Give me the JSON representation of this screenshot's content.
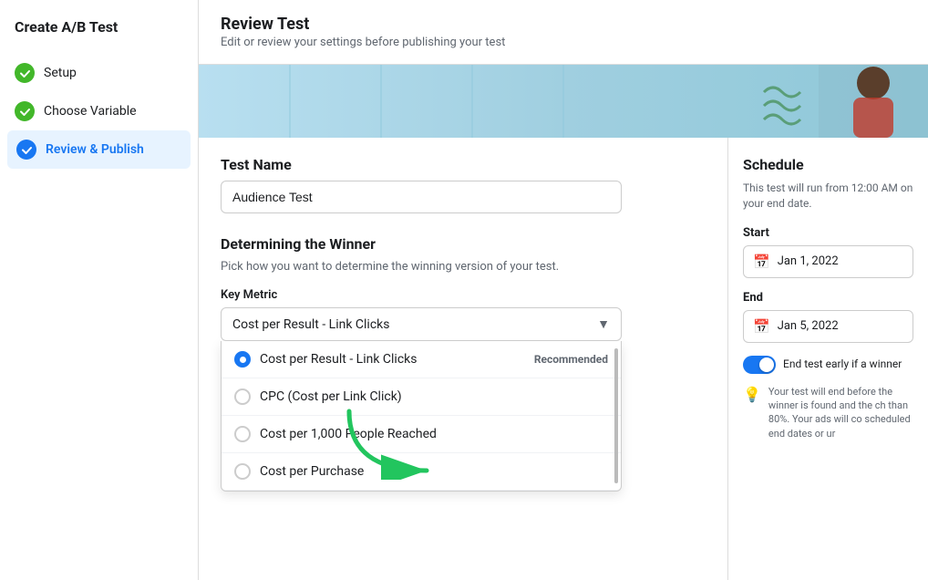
{
  "sidebar": {
    "title": "Create A/B Test",
    "items": [
      {
        "id": "setup",
        "label": "Setup",
        "state": "done"
      },
      {
        "id": "choose-variable",
        "label": "Choose Variable",
        "state": "done"
      },
      {
        "id": "review-publish",
        "label": "Review & Publish",
        "state": "active"
      }
    ]
  },
  "header": {
    "title": "Review Test",
    "subtitle": "Edit or review your settings before publishing your test"
  },
  "main": {
    "test_name_section": {
      "label": "Test Name",
      "value": "Audience Test"
    },
    "winner_section": {
      "title": "Determining the Winner",
      "description": "Pick how you want to determine the winning version of your test.",
      "key_metric_label": "Key Metric",
      "selected_option": "Cost per Result - Link Clicks",
      "options": [
        {
          "id": "cost-per-result",
          "label": "Cost per Result - Link Clicks",
          "recommended": true,
          "selected": true
        },
        {
          "id": "cpc",
          "label": "CPC (Cost per Link Click)",
          "recommended": false,
          "selected": false
        },
        {
          "id": "cost-per-1000",
          "label": "Cost per 1,000 People Reached",
          "recommended": false,
          "selected": false
        },
        {
          "id": "cost-per-purchase",
          "label": "Cost per Purchase",
          "recommended": false,
          "selected": false
        }
      ],
      "recommended_label": "Recommended"
    }
  },
  "schedule": {
    "title": "Schedule",
    "description": "This test will run from 12:00 AM on your end date.",
    "start_label": "Start",
    "start_date": "Jan 1, 2022",
    "end_label": "End",
    "end_date": "Jan 5, 2022",
    "toggle_label": "End test early if a winner",
    "tip_text": "Your test will end before the winner is found and the ch than 80%. Your ads will co scheduled end dates or ur"
  },
  "icons": {
    "check": "✓",
    "chevron_down": "▼",
    "calendar": "📅",
    "bulb": "💡"
  }
}
